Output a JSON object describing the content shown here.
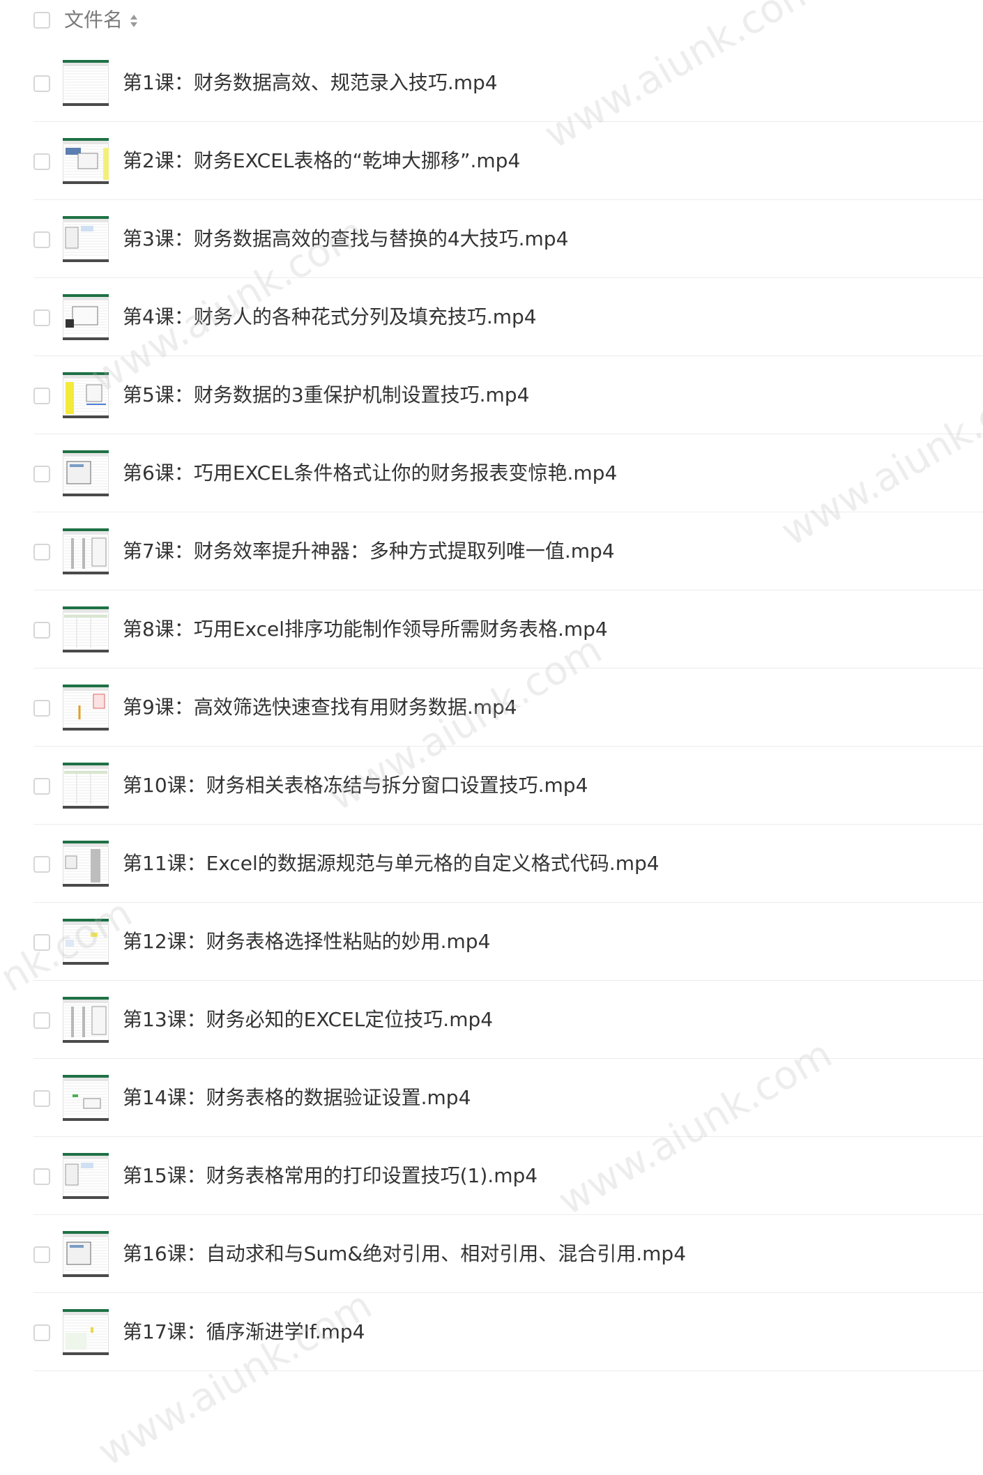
{
  "header": {
    "column_label": "文件名",
    "sort_icon": "sort-updown-icon"
  },
  "files": [
    {
      "name": "第1课：财务数据高效、规范录入技巧.mp4"
    },
    {
      "name": "第2课：财务EXCEL表格的“乾坤大挪移”.mp4"
    },
    {
      "name": "第3课：财务数据高效的查找与替换的4大技巧.mp4"
    },
    {
      "name": "第4课：财务人的各种花式分列及填充技巧.mp4"
    },
    {
      "name": "第5课：财务数据的3重保护机制设置技巧.mp4"
    },
    {
      "name": "第6课：巧用EXCEL条件格式让你的财务报表变惊艳.mp4"
    },
    {
      "name": "第7课：财务效率提升神器：多种方式提取列唯一值.mp4"
    },
    {
      "name": "第8课：巧用Excel排序功能制作领导所需财务表格.mp4"
    },
    {
      "name": "第9课：高效筛选快速查找有用财务数据.mp4"
    },
    {
      "name": "第10课：财务相关表格冻结与拆分窗口设置技巧.mp4"
    },
    {
      "name": "第11课：Excel的数据源规范与单元格的自定义格式代码.mp4"
    },
    {
      "name": "第12课：财务表格选择性粘贴的妙用.mp4"
    },
    {
      "name": "第13课：财务必知的EXCEL定位技巧.mp4"
    },
    {
      "name": "第14课：财务表格的数据验证设置.mp4"
    },
    {
      "name": "第15课：财务表格常用的打印设置技巧(1).mp4"
    },
    {
      "name": "第16课：自动求和与Sum&绝对引用、相对引用、混合引用.mp4"
    },
    {
      "name": "第17课：循序渐进学If.mp4"
    }
  ],
  "watermark": {
    "text": "www.aiunk.com",
    "fragment": "nk.com"
  }
}
